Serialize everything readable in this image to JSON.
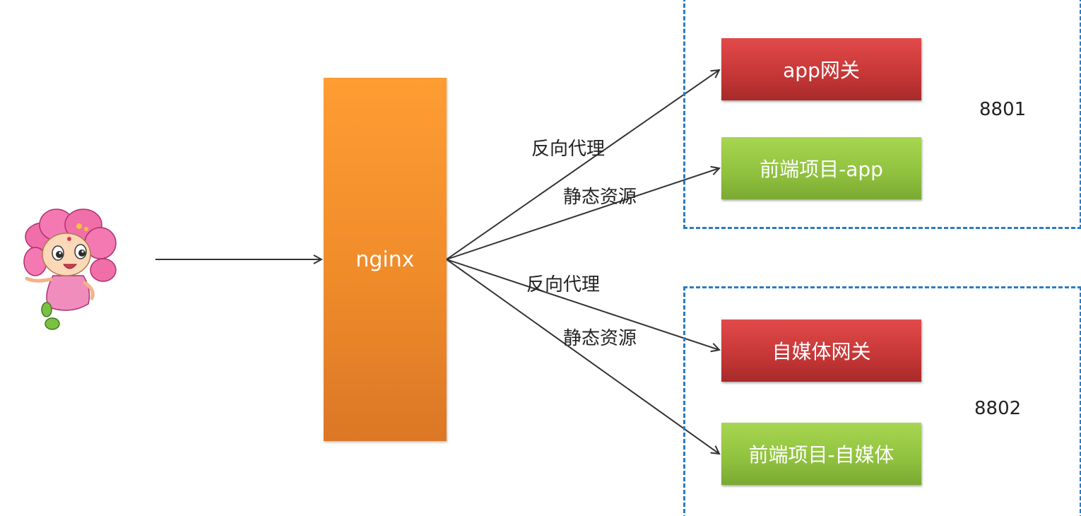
{
  "nodes": {
    "nginx": "nginx",
    "app_gateway": "app网关",
    "frontend_app": "前端项目-app",
    "media_gateway": "自媒体网关",
    "frontend_media": "前端项目-自媒体"
  },
  "edge_labels": {
    "reverse_proxy_top": "反向代理",
    "static_resources_top": "静态资源",
    "reverse_proxy_bottom": "反向代理",
    "static_resources_bottom": "静态资源"
  },
  "groups": {
    "top_port": "8801",
    "bottom_port": "8802"
  },
  "colors": {
    "nginx": "#f39128",
    "gateway": "#c53636",
    "frontend": "#8fc13e",
    "group_border": "#2b7cc4"
  },
  "icons": {
    "user": "flower-mascot-icon"
  }
}
